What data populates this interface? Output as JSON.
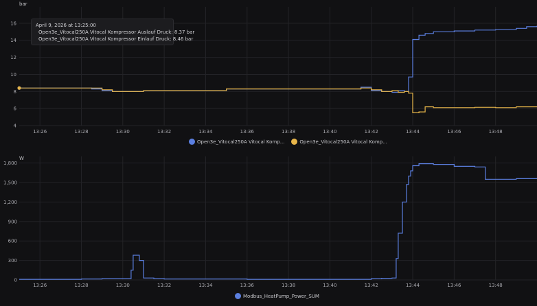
{
  "chart_data": [
    {
      "type": "line",
      "ylabel": "bar",
      "ylim": [
        4,
        17.6
      ],
      "yticks": [
        4,
        6,
        8,
        10,
        12,
        14,
        16
      ],
      "xlim": [
        "13:25",
        "13:50"
      ],
      "xticks": [
        "13:26",
        "13:28",
        "13:30",
        "13:32",
        "13:34",
        "13:36",
        "13:38",
        "13:40",
        "13:42",
        "13:44",
        "13:46",
        "13:48"
      ],
      "grid": true,
      "legend": "bottom",
      "tooltip": {
        "title": "April 9, 2026 at 13:25:00",
        "lines": [
          "Open3e_Vitocal250A Vitocal Kompressor Auslauf Druck: 8.37 bar",
          "Open3e_Vitocal250A Vitocal Kompressor Einlauf Druck: 8.46 bar"
        ]
      },
      "series": [
        {
          "name": "Open3e_Vitocal250A Vitocal Komp...",
          "color": "#5b7fe0",
          "x": [
            "13:25",
            "13:28.5",
            "13:29",
            "13:29.5",
            "13:30",
            "13:31",
            "13:35",
            "13:41.5",
            "13:42",
            "13:42.5",
            "13:43",
            "13:43.3",
            "13:43.6",
            "13:43.8",
            "13:44",
            "13:44.3",
            "13:44.6",
            "13:45",
            "13:46",
            "13:47",
            "13:48",
            "13:49",
            "13:49.5",
            "13:50"
          ],
          "y": [
            8.4,
            8.3,
            8.1,
            8.0,
            8.0,
            8.1,
            8.3,
            8.5,
            8.1,
            8.0,
            7.9,
            8.1,
            8.0,
            9.7,
            14.1,
            14.6,
            14.8,
            15.0,
            15.1,
            15.2,
            15.25,
            15.4,
            15.6,
            15.7
          ]
        },
        {
          "name": "Open3e_Vitocal250A Vitocal Komp...",
          "color": "#e8b64a",
          "x": [
            "13:25",
            "13:28.5",
            "13:29",
            "13:29.5",
            "13:30",
            "13:31",
            "13:35",
            "13:41.5",
            "13:42",
            "13:42.5",
            "13:43",
            "13:43.3",
            "13:43.6",
            "13:43.8",
            "13:44",
            "13:44.3",
            "13:44.6",
            "13:45",
            "13:46",
            "13:47",
            "13:48",
            "13:49",
            "13:50"
          ],
          "y": [
            8.4,
            8.4,
            8.2,
            8.0,
            8.0,
            8.1,
            8.3,
            8.4,
            8.2,
            8.0,
            8.1,
            7.9,
            8.0,
            7.8,
            5.5,
            5.6,
            6.2,
            6.1,
            6.1,
            6.15,
            6.1,
            6.2,
            6.2
          ]
        }
      ]
    },
    {
      "type": "line",
      "ylabel": "W",
      "ylim": [
        0,
        1860
      ],
      "yticks": [
        0,
        300,
        600,
        900,
        1200,
        1500,
        1800
      ],
      "yticklabels": [
        "0",
        "300",
        "600",
        "900",
        "1,200",
        "1,500",
        "1,800"
      ],
      "xlim": [
        "13:25",
        "13:50"
      ],
      "xticks": [
        "13:26",
        "13:28",
        "13:30",
        "13:32",
        "13:34",
        "13:36",
        "13:38",
        "13:40",
        "13:42",
        "13:44",
        "13:46",
        "13:48"
      ],
      "grid": true,
      "legend": "bottom",
      "series": [
        {
          "name": "Modbus_HeatPump_Power_SUM",
          "color": "#5b7fe0",
          "x": [
            "13:25",
            "13:28",
            "13:29",
            "13:30.2",
            "13:30.4",
            "13:30.5",
            "13:30.6",
            "13:30.8",
            "13:31",
            "13:31.5",
            "13:32",
            "13:36",
            "13:41",
            "13:42",
            "13:42.5",
            "13:43",
            "13:43.2",
            "13:43.3",
            "13:43.5",
            "13:43.7",
            "13:43.8",
            "13:43.9",
            "13:44",
            "13:44.3",
            "13:45",
            "13:46",
            "13:47",
            "13:47.5",
            "13:48",
            "13:49",
            "13:50"
          ],
          "y": [
            10,
            15,
            20,
            20,
            150,
            380,
            380,
            300,
            30,
            20,
            15,
            10,
            10,
            20,
            25,
            30,
            330,
            720,
            1200,
            1470,
            1600,
            1680,
            1760,
            1790,
            1780,
            1750,
            1740,
            1550,
            1550,
            1560,
            1555
          ]
        }
      ]
    }
  ]
}
